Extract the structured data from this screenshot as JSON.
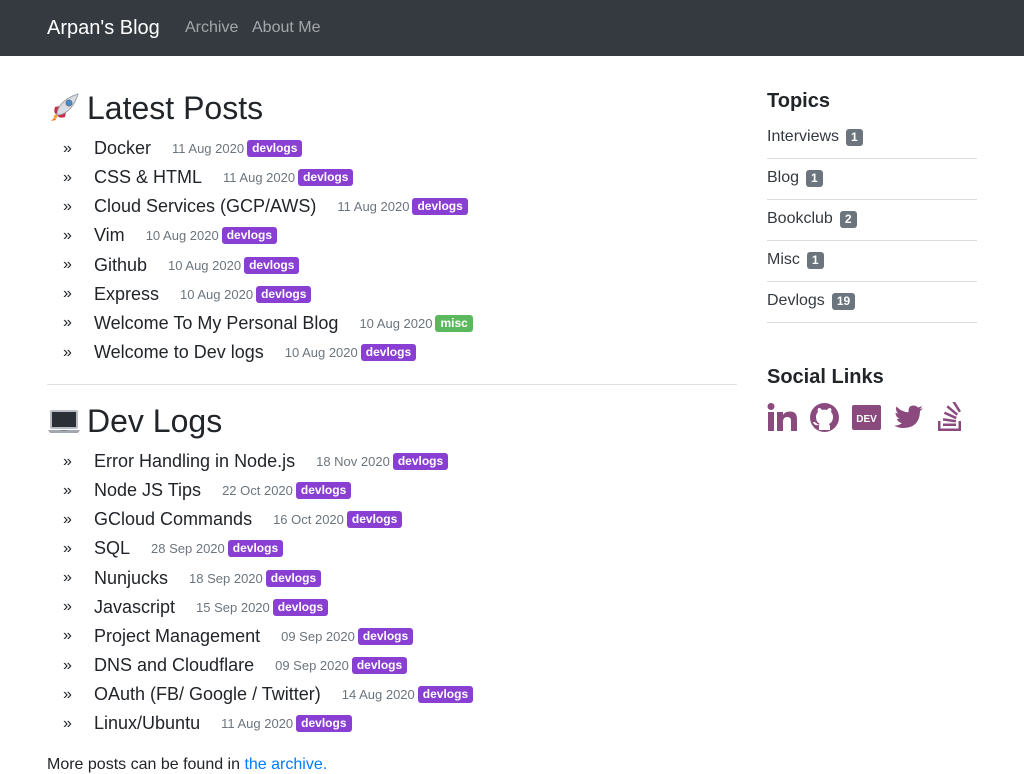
{
  "navbar": {
    "brand": "Arpan's Blog",
    "links": [
      "Archive",
      "About Me"
    ]
  },
  "latest": {
    "emoji": "rocket-icon",
    "title": "Latest Posts",
    "posts": [
      {
        "title": "Docker",
        "date": "11 Aug 2020",
        "tag": "devlogs"
      },
      {
        "title": "CSS & HTML",
        "date": "11 Aug 2020",
        "tag": "devlogs"
      },
      {
        "title": "Cloud Services (GCP/AWS)",
        "date": "11 Aug 2020",
        "tag": "devlogs"
      },
      {
        "title": "Vim",
        "date": "10 Aug 2020",
        "tag": "devlogs"
      },
      {
        "title": "Github",
        "date": "10 Aug 2020",
        "tag": "devlogs"
      },
      {
        "title": "Express",
        "date": "10 Aug 2020",
        "tag": "devlogs"
      },
      {
        "title": "Welcome To My Personal Blog",
        "date": "10 Aug 2020",
        "tag": "misc"
      },
      {
        "title": "Welcome to Dev logs",
        "date": "10 Aug 2020",
        "tag": "devlogs"
      }
    ]
  },
  "devlogs": {
    "emoji": "laptop-icon",
    "title": "Dev Logs",
    "posts": [
      {
        "title": "Error Handling in Node.js",
        "date": "18 Nov 2020",
        "tag": "devlogs"
      },
      {
        "title": "Node JS Tips",
        "date": "22 Oct 2020",
        "tag": "devlogs"
      },
      {
        "title": "GCloud Commands",
        "date": "16 Oct 2020",
        "tag": "devlogs"
      },
      {
        "title": "SQL",
        "date": "28 Sep 2020",
        "tag": "devlogs"
      },
      {
        "title": "Nunjucks",
        "date": "18 Sep 2020",
        "tag": "devlogs"
      },
      {
        "title": "Javascript",
        "date": "15 Sep 2020",
        "tag": "devlogs"
      },
      {
        "title": "Project Management",
        "date": "09 Sep 2020",
        "tag": "devlogs"
      },
      {
        "title": "DNS and Cloudflare",
        "date": "09 Sep 2020",
        "tag": "devlogs"
      },
      {
        "title": "OAuth (FB/ Google / Twitter)",
        "date": "14 Aug 2020",
        "tag": "devlogs"
      },
      {
        "title": "Linux/Ubuntu",
        "date": "11 Aug 2020",
        "tag": "devlogs"
      }
    ]
  },
  "more": {
    "prefix": "More posts can be found in ",
    "link": "the archive."
  },
  "sidebar": {
    "topics_title": "Topics",
    "topics": [
      {
        "name": "Interviews",
        "count": "1"
      },
      {
        "name": "Blog",
        "count": "1"
      },
      {
        "name": "Bookclub",
        "count": "2"
      },
      {
        "name": "Misc",
        "count": "1"
      },
      {
        "name": "Devlogs",
        "count": "19"
      }
    ],
    "social_title": "Social Links",
    "social_icons": [
      "linkedin-icon",
      "github-icon",
      "dev-icon",
      "twitter-icon",
      "stackoverflow-icon"
    ]
  },
  "colors": {
    "navbar": "#343a40",
    "devlogs_badge": "#8a3fd3",
    "misc_badge": "#5cb85c",
    "count_badge": "#6c757d",
    "social_icon": "#8a4a7d",
    "link": "#007bff"
  }
}
